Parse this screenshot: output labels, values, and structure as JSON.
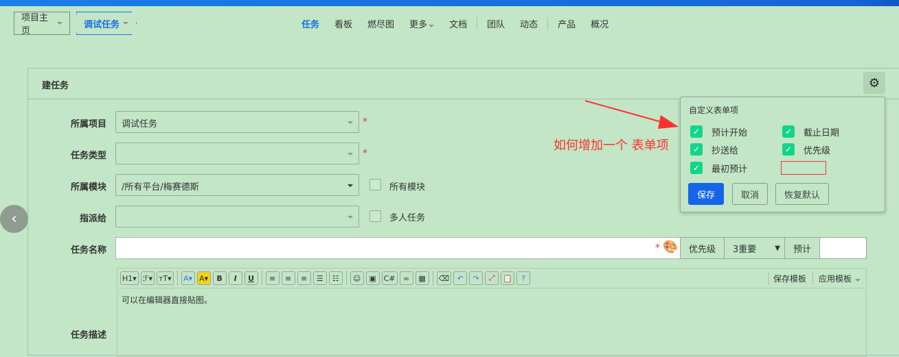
{
  "breadcrumb": {
    "home": "项目主页",
    "current": "调试任务"
  },
  "nav": {
    "items": [
      "任务",
      "看板",
      "燃尽图",
      "更多",
      "文档",
      "团队",
      "动态",
      "产品",
      "概况"
    ]
  },
  "panel": {
    "title": "建任务"
  },
  "form": {
    "project_label": "所属项目",
    "project_value": "调试任务",
    "type_label": "任务类型",
    "type_value": "",
    "module_label": "所属模块",
    "module_value": "/所有平台/梅赛德斯",
    "all_modules": "所有模块",
    "assign_label": "指派给",
    "assign_value": "",
    "multi_task": "多人任务",
    "name_label": "任务名称",
    "name_value": "",
    "priority_label": "优先级",
    "priority_value": "3重要",
    "estimate_label": "预计",
    "estimate_value": "",
    "desc_label": "任务描述",
    "desc_value": "可以在编辑器直接贴图。",
    "save_template": "保存模板",
    "apply_template": "应用模板",
    "required": "*"
  },
  "popup": {
    "title": "自定义表单项",
    "fields": [
      {
        "label": "预计开始",
        "checked": true
      },
      {
        "label": "截止日期",
        "checked": true
      },
      {
        "label": "抄送给",
        "checked": true
      },
      {
        "label": "优先级",
        "checked": true
      },
      {
        "label": "最初预计",
        "checked": true
      }
    ],
    "save": "保存",
    "cancel": "取消",
    "reset": "恢复默认"
  },
  "annotation": {
    "text": "如何增加一个 表单项",
    "color": "#ff3030"
  },
  "colors": {
    "accent": "#1a6fe8",
    "check": "#12d58a"
  }
}
